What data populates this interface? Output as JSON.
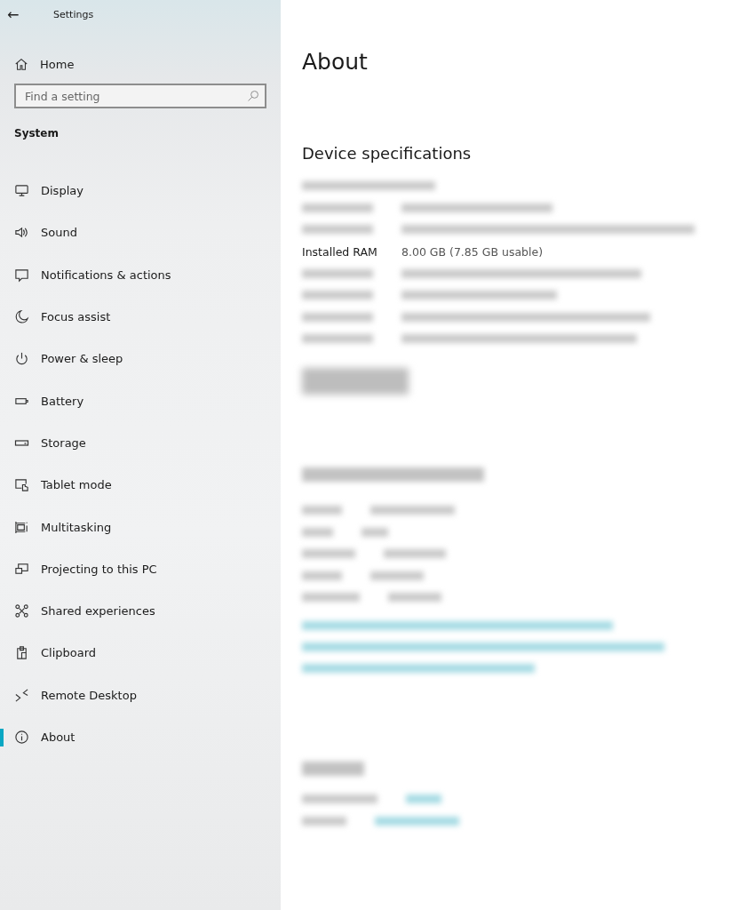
{
  "window": {
    "title": "Settings",
    "back": "←"
  },
  "sidebar": {
    "home": "Home",
    "search": {
      "placeholder": "Find a setting"
    },
    "section": "System",
    "items": [
      {
        "label": "Display",
        "selected": false
      },
      {
        "label": "Sound",
        "selected": false
      },
      {
        "label": "Notifications & actions",
        "selected": false
      },
      {
        "label": "Focus assist",
        "selected": false
      },
      {
        "label": "Power & sleep",
        "selected": false
      },
      {
        "label": "Battery",
        "selected": false
      },
      {
        "label": "Storage",
        "selected": false
      },
      {
        "label": "Tablet mode",
        "selected": false
      },
      {
        "label": "Multitasking",
        "selected": false
      },
      {
        "label": "Projecting to this PC",
        "selected": false
      },
      {
        "label": "Shared experiences",
        "selected": false
      },
      {
        "label": "Clipboard",
        "selected": false
      },
      {
        "label": "Remote Desktop",
        "selected": false
      },
      {
        "label": "About",
        "selected": true
      }
    ]
  },
  "main": {
    "title": "About",
    "device_specifications": {
      "heading": "Device specifications",
      "rows": [
        {
          "label": "Installed RAM",
          "value": "8.00 GB (7.85 GB usable)"
        }
      ]
    }
  }
}
